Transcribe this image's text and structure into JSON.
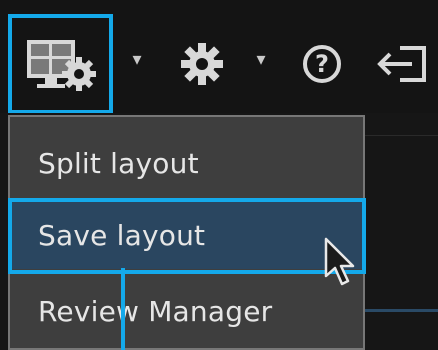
{
  "toolbar": {
    "layout_icon": "layout-settings-icon",
    "dropdown_caret": "▾",
    "settings_icon": "gear-icon",
    "help_icon": "help-icon",
    "help_glyph": "?",
    "logout_icon": "logout-icon"
  },
  "menu": {
    "items": [
      {
        "label": "Split layout"
      },
      {
        "label": "Save layout"
      },
      {
        "label": "Review Manager"
      }
    ],
    "selected": 1
  },
  "colors": {
    "highlight": "#14a9ea",
    "menu_bg": "#3e3e3e",
    "selected_bg": "#2a4660"
  }
}
